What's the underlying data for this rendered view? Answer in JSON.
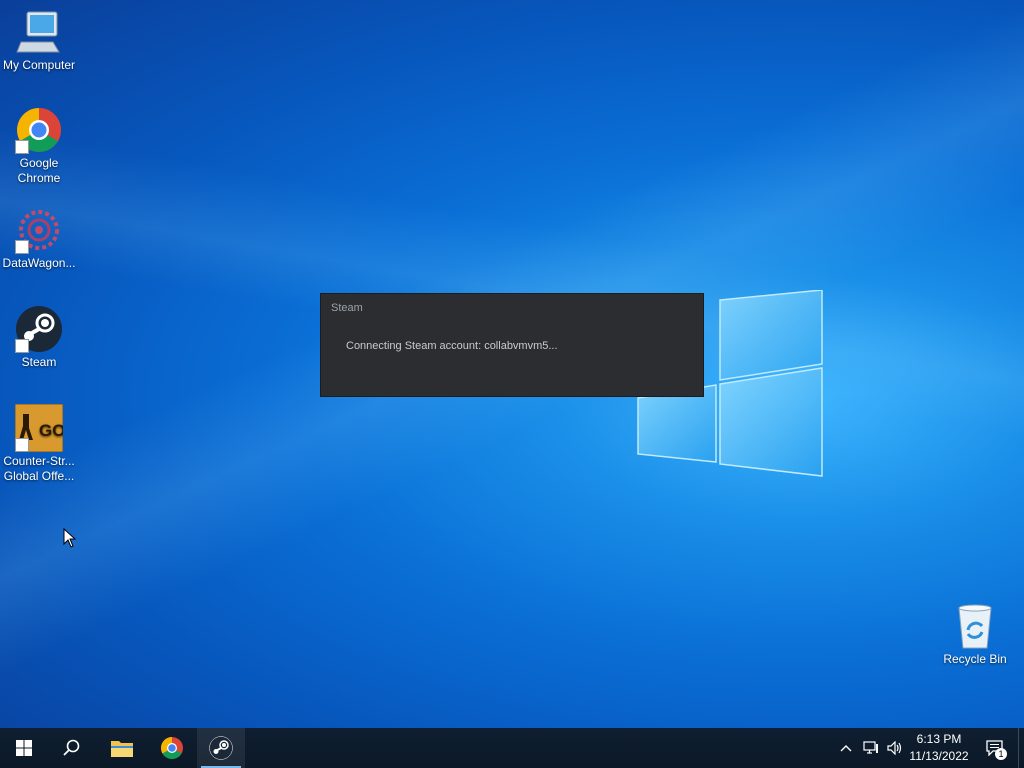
{
  "desktop": {
    "icons": [
      {
        "label": "My Computer",
        "icon": "computer-icon"
      },
      {
        "label": "Google Chrome",
        "icon": "chrome-icon"
      },
      {
        "label": "DataWagon...",
        "icon": "datawagon-icon"
      },
      {
        "label": "Steam",
        "icon": "steam-icon"
      },
      {
        "label": "Counter-Str... Global Offe...",
        "label_line1": "Counter-Str...",
        "label_line2": "Global Offe...",
        "icon": "csgo-icon"
      },
      {
        "label": "Recycle Bin",
        "icon": "recycle-bin-icon"
      }
    ]
  },
  "steam_dialog": {
    "title": "Steam",
    "message": "Connecting Steam account: collabvmvm5..."
  },
  "taskbar": {
    "pinned": [
      "start-icon",
      "search-icon",
      "file-explorer-icon",
      "chrome-icon",
      "steam-icon"
    ],
    "active": "steam-icon",
    "clock_time": "6:13 PM",
    "clock_date": "11/13/2022",
    "notification_count": "1"
  },
  "colors": {
    "taskbar": "#0c1a2a",
    "dialog_bg": "#2b2d31",
    "desktop_accent": "#0a6fd6"
  }
}
